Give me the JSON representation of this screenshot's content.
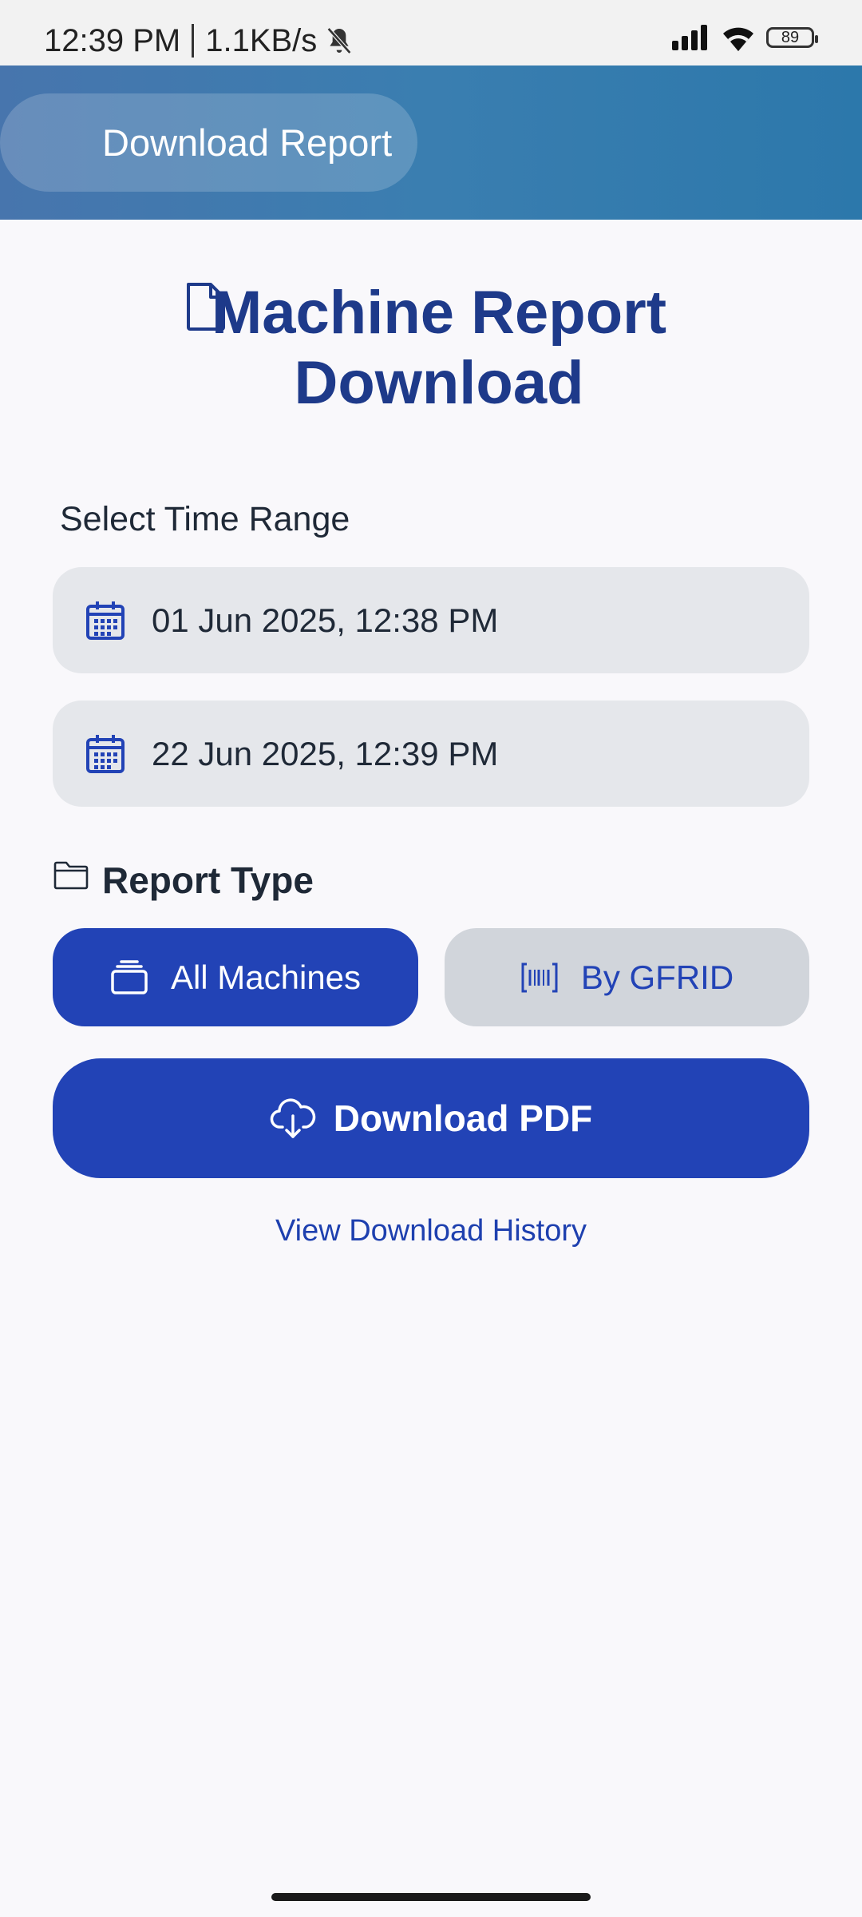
{
  "status_bar": {
    "time": "12:39 PM",
    "network_speed": "1.1KB/s",
    "battery": "89",
    "icons": [
      "mute-bell-icon",
      "signal-icon",
      "wifi-icon",
      "battery-icon"
    ]
  },
  "header": {
    "title": "Download Report"
  },
  "page": {
    "title_line1": "Machine Report",
    "title_line2": "Download"
  },
  "time_range": {
    "label": "Select Time Range",
    "start": "01 Jun 2025, 12:38 PM",
    "end": "22 Jun 2025, 12:39 PM"
  },
  "report_type": {
    "label": "Report Type",
    "options": [
      {
        "label": "All Machines",
        "selected": true,
        "icon": "stack-icon"
      },
      {
        "label": "By GFRID",
        "selected": false,
        "icon": "barcode-icon"
      }
    ]
  },
  "actions": {
    "download_label": "Download PDF",
    "history_label": "View Download History"
  },
  "colors": {
    "primary": "#2243b6",
    "title": "#1e3a8a",
    "header_gradient_start": "#4775ad",
    "header_gradient_end": "#2c78ab",
    "field_bg": "#e5e7eb",
    "inactive_bg": "#d1d5db"
  }
}
